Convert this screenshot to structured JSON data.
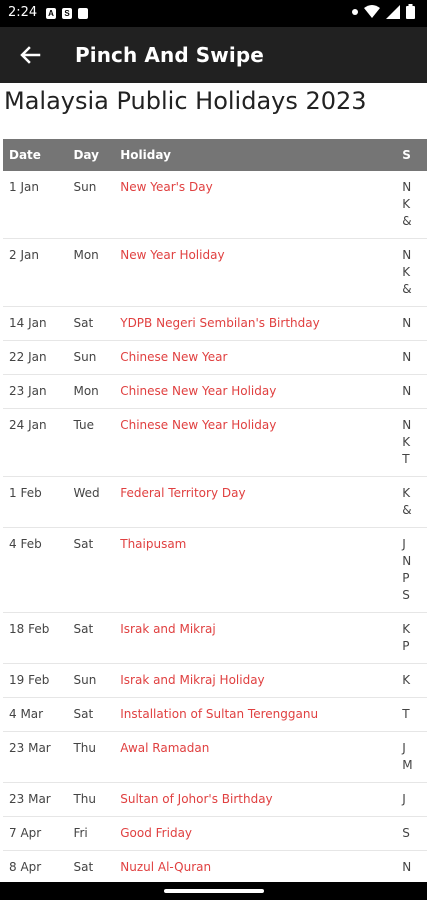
{
  "status_bar": {
    "time": "2:24",
    "icons": [
      "a-icon",
      "sync-icon",
      "sd-card-icon",
      "wifi-icon",
      "signal-icon",
      "battery-icon"
    ]
  },
  "app_bar": {
    "title": "Pinch And Swipe",
    "back_icon": "arrow-back-icon"
  },
  "page_title": "Malaysia Public Holidays 2023",
  "table": {
    "headers": {
      "date": "Date",
      "day": "Day",
      "holiday": "Holiday",
      "state": "S"
    },
    "rows": [
      {
        "date": "1 Jan",
        "day": "Sun",
        "holiday": "New Year's Day",
        "state": [
          "N",
          "K",
          "&"
        ]
      },
      {
        "date": "2 Jan",
        "day": "Mon",
        "holiday": "New Year Holiday",
        "state": [
          "N",
          "K",
          "&"
        ]
      },
      {
        "date": "14 Jan",
        "day": "Sat",
        "holiday": "YDPB Negeri Sembilan's Birthday",
        "state": [
          "N"
        ]
      },
      {
        "date": "22 Jan",
        "day": "Sun",
        "holiday": "Chinese New Year",
        "state": [
          "N"
        ]
      },
      {
        "date": "23 Jan",
        "day": "Mon",
        "holiday": "Chinese New Year Holiday",
        "state": [
          "N"
        ]
      },
      {
        "date": "24 Jan",
        "day": "Tue",
        "holiday": "Chinese New Year Holiday",
        "state": [
          "N",
          "K",
          "T"
        ]
      },
      {
        "date": "1 Feb",
        "day": "Wed",
        "holiday": "Federal Territory Day",
        "state": [
          "K",
          "&"
        ]
      },
      {
        "date": "4 Feb",
        "day": "Sat",
        "holiday": "Thaipusam",
        "state": [
          "J",
          "N",
          "P",
          "S"
        ]
      },
      {
        "date": "18 Feb",
        "day": "Sat",
        "holiday": "Israk and Mikraj",
        "state": [
          "K",
          "P"
        ]
      },
      {
        "date": "19 Feb",
        "day": "Sun",
        "holiday": "Israk and Mikraj Holiday",
        "state": [
          "K"
        ]
      },
      {
        "date": "4 Mar",
        "day": "Sat",
        "holiday": "Installation of Sultan Terengganu",
        "state": [
          "T"
        ]
      },
      {
        "date": "23 Mar",
        "day": "Thu",
        "holiday": "Awal Ramadan",
        "state": [
          "J",
          "M"
        ]
      },
      {
        "date": "23 Mar",
        "day": "Thu",
        "holiday": "Sultan of Johor's Birthday",
        "state": [
          "J"
        ]
      },
      {
        "date": "7 Apr",
        "day": "Fri",
        "holiday": "Good Friday",
        "state": [
          "S"
        ]
      },
      {
        "date": "8 Apr",
        "day": "Sat",
        "holiday": "Nuzul Al-Quran",
        "state": [
          "N"
        ]
      }
    ]
  },
  "colors": {
    "app_bar": "#212121",
    "header_bg": "#757575",
    "holiday_link": "#e04040"
  }
}
